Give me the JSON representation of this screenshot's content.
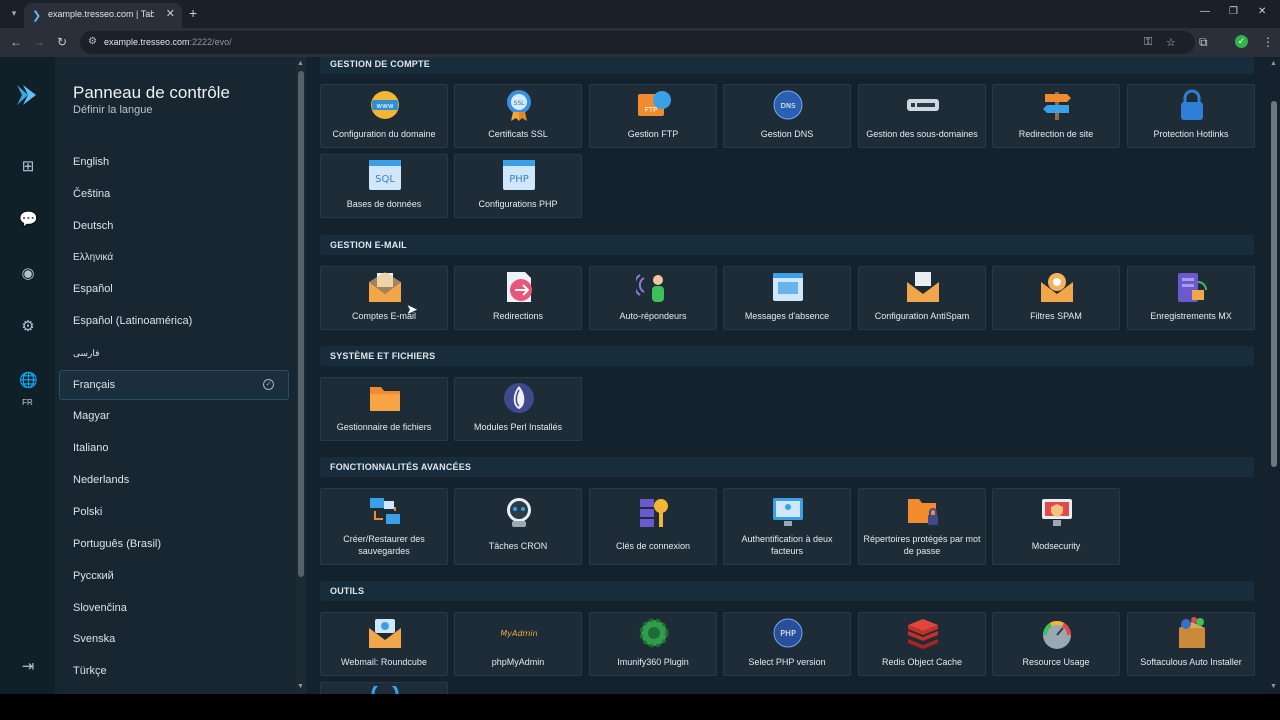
{
  "browser": {
    "tab_title": "example.tresseo.com | Tableau",
    "url_host": "example.tresseo.com",
    "url_rest": ":2222/evo/"
  },
  "panel": {
    "title": "Panneau de contrôle",
    "subtitle": "Définir la langue",
    "lang_code": "FR",
    "languages": [
      "English",
      "Čeština",
      "Deutsch",
      "Ελληνικά",
      "Español",
      "Español (Latinoamérica)",
      "فارسی",
      "Français",
      "Magyar",
      "Italiano",
      "Nederlands",
      "Polski",
      "Português (Brasil)",
      "Русский",
      "Slovenčina",
      "Svenska",
      "Türkçe"
    ],
    "selected_language": "Français"
  },
  "sections": {
    "compte": {
      "title": "GESTION DE COMPTE",
      "items": [
        "Configuration du domaine",
        "Certificats SSL",
        "Gestion FTP",
        "Gestion DNS",
        "Gestion des sous-domaines",
        "Redirection de site",
        "Protection Hotlinks",
        "Bases de données",
        "Configurations PHP"
      ]
    },
    "email": {
      "title": "GESTION E-MAIL",
      "items": [
        "Comptes E-mail",
        "Redirections",
        "Auto-répondeurs",
        "Messages d'absence",
        "Configuration AntiSpam",
        "Filtres SPAM",
        "Enregistrements MX"
      ]
    },
    "systeme": {
      "title": "SYSTÈME ET FICHIERS",
      "items": [
        "Gestionnaire de fichiers",
        "Modules Perl Installés"
      ]
    },
    "avance": {
      "title": "FONCTIONNALITÉS AVANCÉES",
      "items": [
        "Créer/Restaurer des sauvegardes",
        "Tâches CRON",
        "Clés de connexion",
        "Authentification à deux facteurs",
        "Répertoires protégés par mot de passe",
        "Modsecurity"
      ]
    },
    "outils": {
      "title": "OUTILS",
      "items": [
        "Webmail: Roundcube",
        "phpMyAdmin",
        "Imunify360 Plugin",
        "Select PHP version",
        "Redis Object Cache",
        "Resource Usage",
        "Softaculous Auto Installer"
      ]
    }
  },
  "icon_text": {
    "www": "www",
    "ssl": "SSL",
    "ftp": "FTP",
    "dns": "DNS",
    "sql": "SQL",
    "php": "PHP",
    "myadmin": "MyAdmin"
  }
}
